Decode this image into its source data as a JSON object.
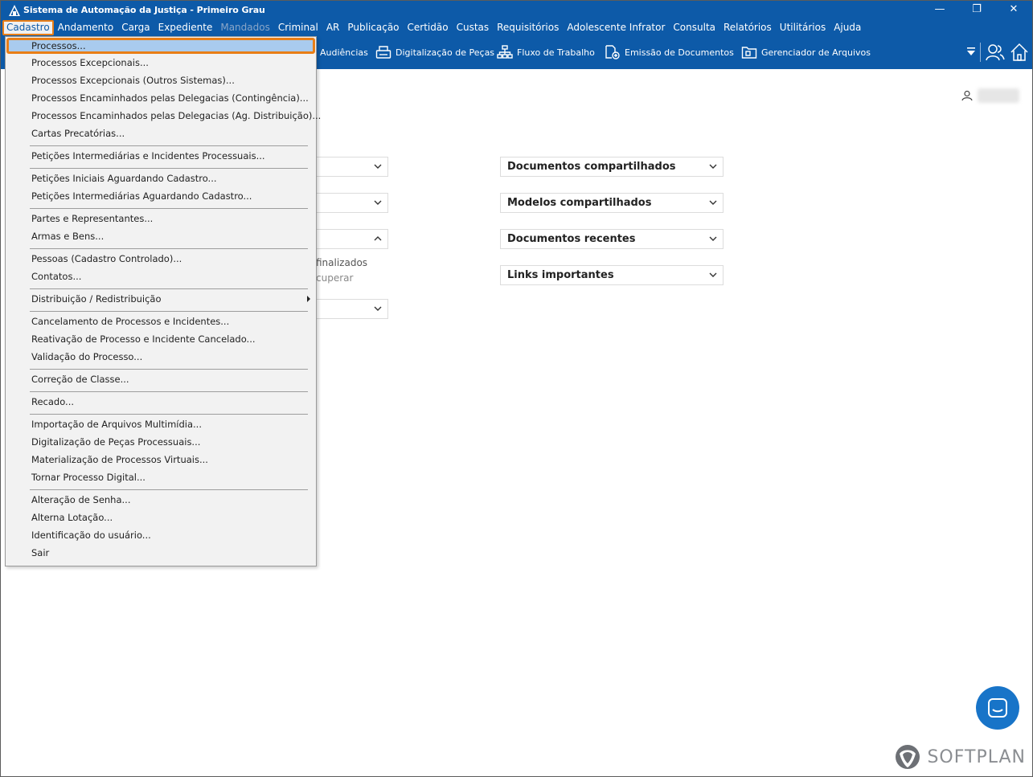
{
  "window": {
    "title": "Sistema de Automação da Justiça - Primeiro Grau",
    "minimize": "—",
    "restore": "❐",
    "close": "✕"
  },
  "menubar": {
    "items": [
      {
        "label": "Cadastro",
        "active": true
      },
      {
        "label": "Andamento"
      },
      {
        "label": "Carga"
      },
      {
        "label": "Expediente"
      },
      {
        "label": "Mandados",
        "disabled": true
      },
      {
        "label": "Criminal"
      },
      {
        "label": "AR"
      },
      {
        "label": "Publicação"
      },
      {
        "label": "Certidão"
      },
      {
        "label": "Custas"
      },
      {
        "label": "Requisitórios"
      },
      {
        "label": "Adolescente Infrator"
      },
      {
        "label": "Consulta"
      },
      {
        "label": "Relatórios"
      },
      {
        "label": "Utilitários"
      },
      {
        "label": "Ajuda"
      }
    ]
  },
  "toolbar": {
    "audiencias": "Audiências",
    "digitalizacao": "Digitalização de Peças",
    "fluxo": "Fluxo de Trabalho",
    "emissao": "Emissão de Documentos",
    "gerenciador": "Gerenciador de Arquivos"
  },
  "dropdown": {
    "items": [
      "Processos...",
      "Processos Excepcionais...",
      "Processos Excepcionais (Outros Sistemas)...",
      "Processos Encaminhados pelas Delegacias (Contingência)...",
      "Processos Encaminhados pelas Delegacias (Ag. Distribuição)...",
      "Cartas Precatórias...",
      "Petições Intermediárias e Incidentes Processuais...",
      "Petições Iniciais Aguardando Cadastro...",
      "Petições Intermediárias Aguardando Cadastro...",
      "Partes e Representantes...",
      "Armas e Bens...",
      "Pessoas (Cadastro Controlado)...",
      "Contatos...",
      "Distribuição / Redistribuição",
      "Cancelamento de Processos e Incidentes...",
      "Reativação de Processo e Incidente Cancelado...",
      "Validação do Processo...",
      "Correção de Classe...",
      "Recado...",
      "Importação de Arquivos Multimídia...",
      "Digitalização de Peças Processuais...",
      "Materialização de Processos Virtuais...",
      "Tornar Processo Digital...",
      "Alteração de Senha...",
      "Alterna Lotação...",
      "Identificação do usuário...",
      "Sair"
    ]
  },
  "panels": {
    "documentos_compartilhados": "Documentos compartilhados",
    "modelos_compartilhados": "Modelos compartilhados",
    "documentos_recentes": "Documentos recentes",
    "links_importantes": "Links importantes"
  },
  "partial_text": {
    "finalizados": "finalizados",
    "recuperar": "cuperar"
  },
  "brand": {
    "softplan": "SOFTPLAN",
    "accent": "#e97e16",
    "primary": "#0d5aa8"
  }
}
